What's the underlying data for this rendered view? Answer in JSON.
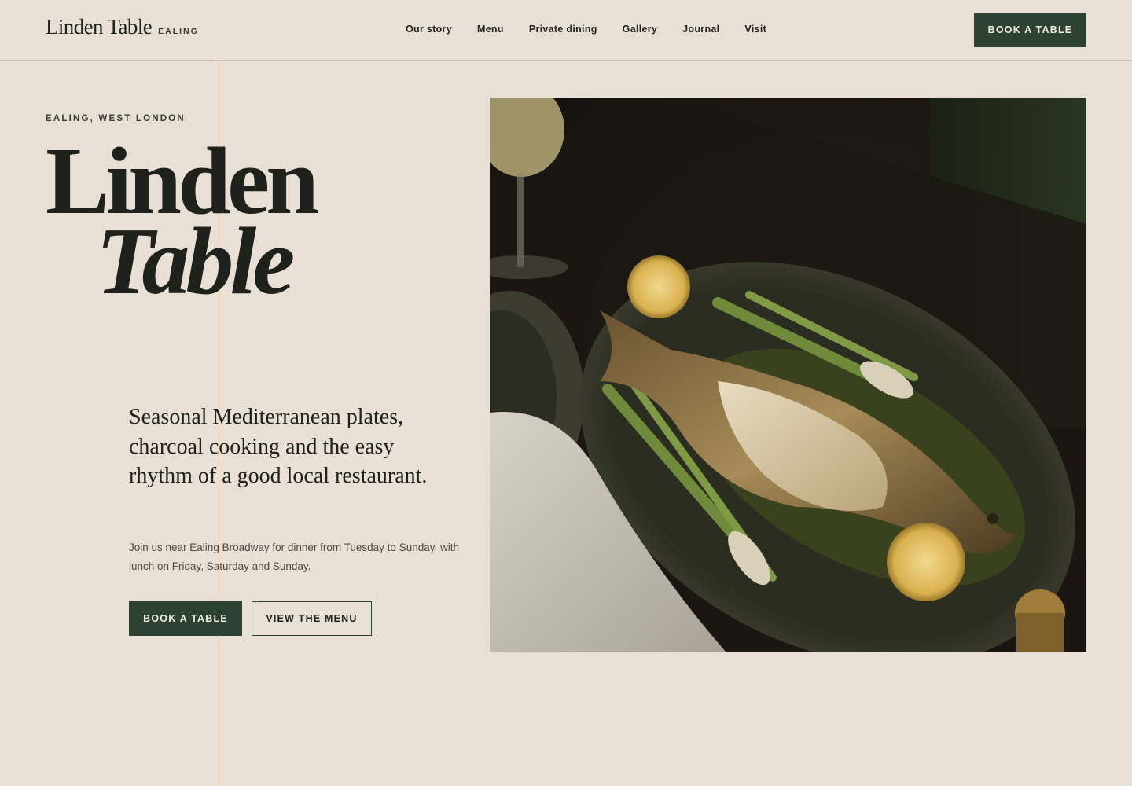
{
  "header": {
    "brand_name": "Linden Table",
    "brand_location": "EALING",
    "nav": [
      {
        "label": "Our story"
      },
      {
        "label": "Menu"
      },
      {
        "label": "Private dining"
      },
      {
        "label": "Gallery"
      },
      {
        "label": "Journal"
      },
      {
        "label": "Visit"
      }
    ],
    "cta_label": "BOOK A TABLE"
  },
  "hero": {
    "eyebrow": "EALING, WEST LONDON",
    "title_line1": "Linden",
    "title_line2": "Table",
    "lede": "Seasonal Mediterranean plates, charcoal cooking and the easy rhythm of a good local restaurant.",
    "body": "Join us near Ealing Broadway for dinner from Tuesday to Sunday, with lunch on Friday, Saturday and Sunday.",
    "primary_cta": "BOOK A TABLE",
    "secondary_cta": "VIEW THE MENU",
    "image_subject": "grilled whole fish on an oval plate with charred spring onions, lemon halves and herbs"
  },
  "colors": {
    "background": "#e8e0d4",
    "accent_green": "#2d4232",
    "text": "#1f211d",
    "rule": "#b6987a"
  }
}
